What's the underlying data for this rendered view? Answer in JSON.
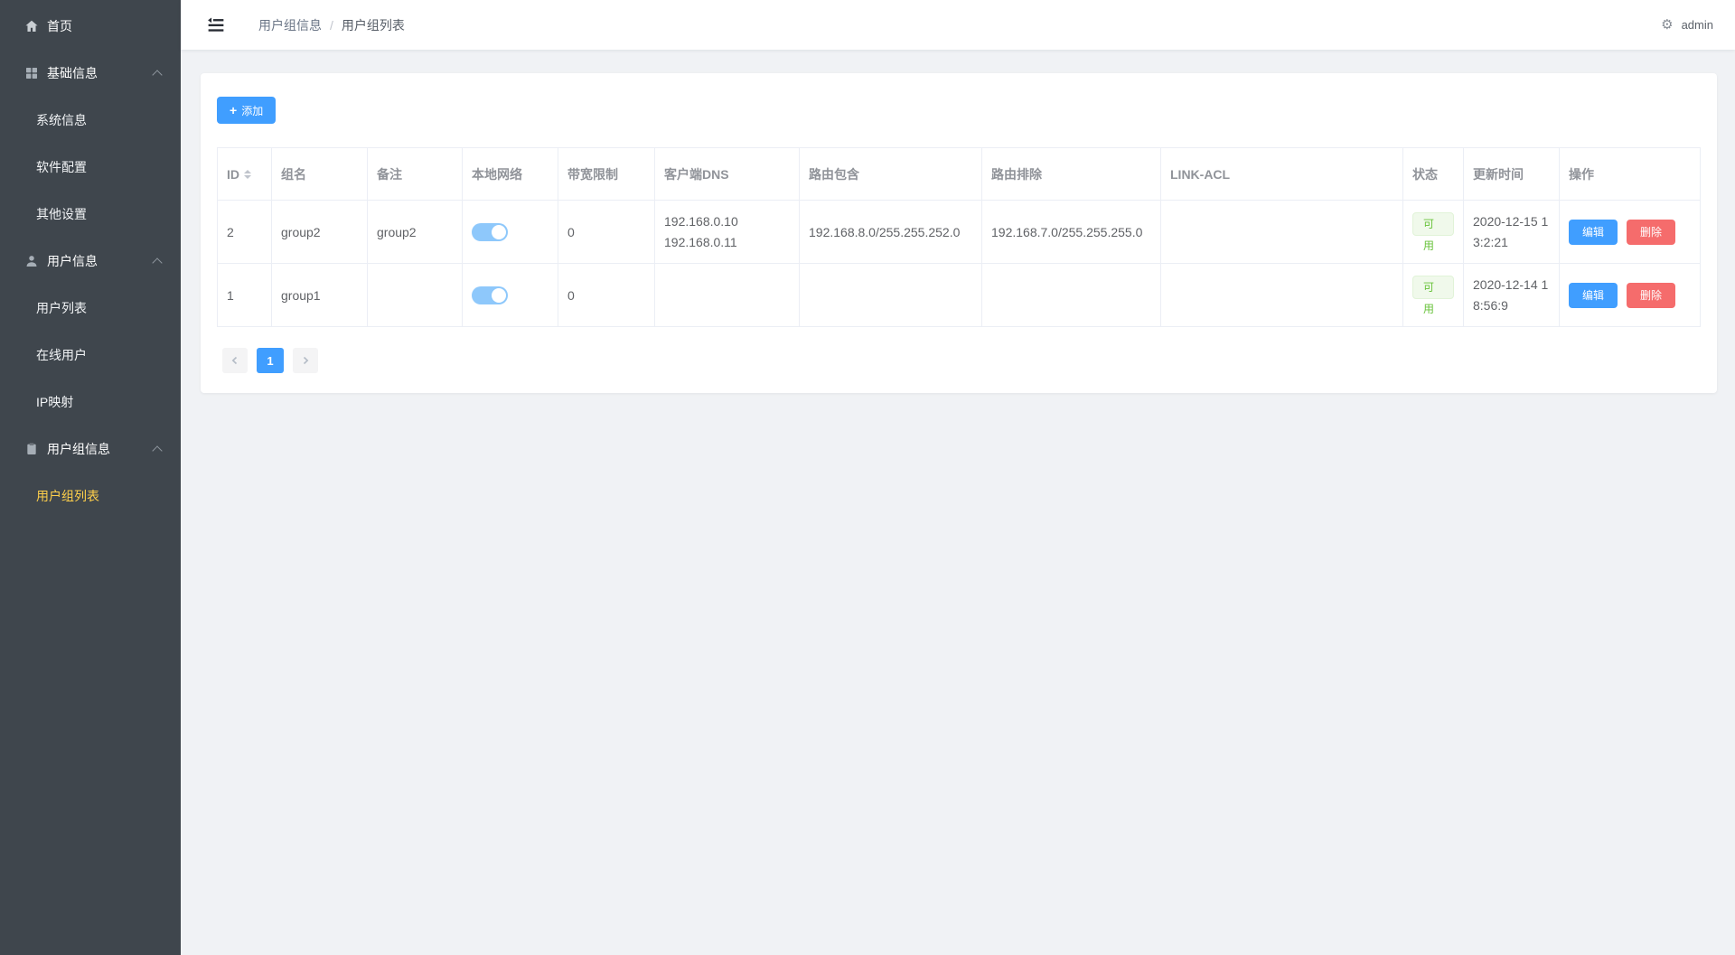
{
  "sidebar": {
    "home_label": "首页",
    "sections": [
      {
        "label": "基础信息",
        "items": [
          "系统信息",
          "软件配置",
          "其他设置"
        ]
      },
      {
        "label": "用户信息",
        "items": [
          "用户列表",
          "在线用户",
          "IP映射"
        ]
      },
      {
        "label": "用户组信息",
        "items": [
          "用户组列表"
        ]
      }
    ],
    "active_item": "用户组列表"
  },
  "topbar": {
    "breadcrumb": [
      "用户组信息",
      "用户组列表"
    ],
    "breadcrumb_separator": "/",
    "gear_icon": "⚙",
    "username": "admin"
  },
  "toolbar": {
    "plus_icon": "+",
    "add_label": "添加"
  },
  "table": {
    "columns": [
      "ID",
      "组名",
      "备注",
      "本地网络",
      "带宽限制",
      "客户端DNS",
      "路由包含",
      "路由排除",
      "LINK-ACL",
      "状态",
      "更新时间",
      "操作"
    ],
    "edit_label": "编辑",
    "delete_label": "删除",
    "rows": [
      {
        "id": "2",
        "group_name": "group2",
        "remark": "group2",
        "local_network": "on",
        "bandwidth_limit": "0",
        "client_dns": "192.168.0.10\n192.168.0.11",
        "route_include": "192.168.8.0/255.255.252.0",
        "route_exclude": "192.168.7.0/255.255.255.0",
        "link_acl": "",
        "status": "可用",
        "updated_at": "2020-12-15 13:2:21"
      },
      {
        "id": "1",
        "group_name": "group1",
        "remark": "",
        "local_network": "on",
        "bandwidth_limit": "0",
        "client_dns": "",
        "route_include": "",
        "route_exclude": "",
        "link_acl": "",
        "status": "可用",
        "updated_at": "2020-12-14 18:56:9"
      }
    ]
  },
  "pagination": {
    "current_page": "1"
  },
  "colors": {
    "primary": "#409eff",
    "danger": "#f56c6c",
    "success_text": "#67c23a",
    "success_bg": "#f0f9eb",
    "success_border": "#e1f3d8",
    "sidebar_bg": "#3f464d",
    "sidebar_active": "#ffd04b",
    "switch_on": "#8ec8fb",
    "content_bg": "#f0f2f5"
  }
}
